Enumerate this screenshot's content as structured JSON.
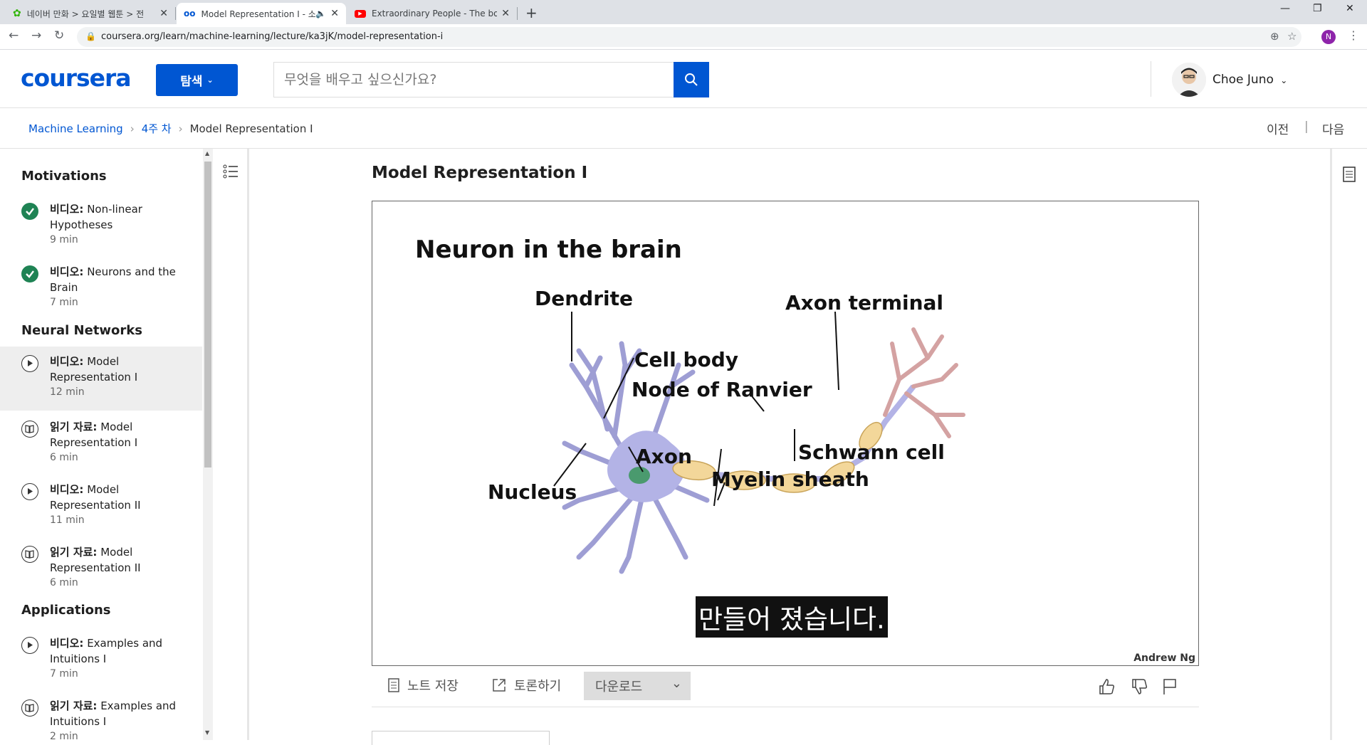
{
  "browser": {
    "tabs": [
      {
        "title": "네이버 만화 > 요일별 웹툰 > 전",
        "active": false
      },
      {
        "title": "Model Representation I - 소",
        "active": true
      },
      {
        "title": "Extraordinary People - The boy",
        "active": false
      }
    ],
    "url": "coursera.org/learn/machine-learning/lecture/ka3jK/model-representation-i",
    "profile_initial": "N"
  },
  "header": {
    "logo": "coursera",
    "explore_label": "탐색",
    "search_placeholder": "무엇을 배우고 싶으신가요?",
    "user_name": "Choe Juno"
  },
  "breadcrumb": {
    "course": "Machine Learning",
    "week": "4주 차",
    "current": "Model Representation I",
    "prev": "이전",
    "divider": "|",
    "next": "다음"
  },
  "sidebar": {
    "sections": [
      {
        "title": "Motivations",
        "items": [
          {
            "type": "비디오:",
            "title": "Non-linear Hypotheses",
            "duration": "9 min",
            "status": "done"
          },
          {
            "type": "비디오:",
            "title": "Neurons and the Brain",
            "duration": "7 min",
            "status": "done"
          }
        ]
      },
      {
        "title": "Neural Networks",
        "items": [
          {
            "type": "비디오:",
            "title": "Model Representation I",
            "duration": "12 min",
            "status": "current"
          },
          {
            "type": "읽기 자료:",
            "title": "Model Representation I",
            "duration": "6 min",
            "status": "reading"
          },
          {
            "type": "비디오:",
            "title": "Model Representation II",
            "duration": "11 min",
            "status": "video"
          },
          {
            "type": "읽기 자료:",
            "title": "Model Representation II",
            "duration": "6 min",
            "status": "reading"
          }
        ]
      },
      {
        "title": "Applications",
        "items": [
          {
            "type": "비디오:",
            "title": "Examples and Intuitions I",
            "duration": "7 min",
            "status": "video"
          },
          {
            "type": "읽기 자료:",
            "title": "Examples and Intuitions I",
            "duration": "2 min",
            "status": "reading"
          }
        ]
      }
    ]
  },
  "main": {
    "title": "Model Representation I",
    "slide": {
      "title": "Neuron in the brain",
      "labels": {
        "dendrite": "Dendrite",
        "axon_terminal": "Axon terminal",
        "cell_body": "Cell body",
        "node_of_ranvier": "Node of Ranvier",
        "schwann_cell": "Schwann cell",
        "axon": "Axon",
        "myelin_sheath": "Myelin sheath",
        "nucleus": "Nucleus"
      },
      "credit": "Andrew Ng",
      "caption": "만들어 졌습니다."
    },
    "actions": {
      "save_note": "노트 저장",
      "discuss": "토론하기",
      "download": "다운로드"
    }
  },
  "colors": {
    "brand": "#0056d2",
    "done": "#1f8354",
    "neuron": "#b3b3e6",
    "myelin": "#f3d79a"
  }
}
